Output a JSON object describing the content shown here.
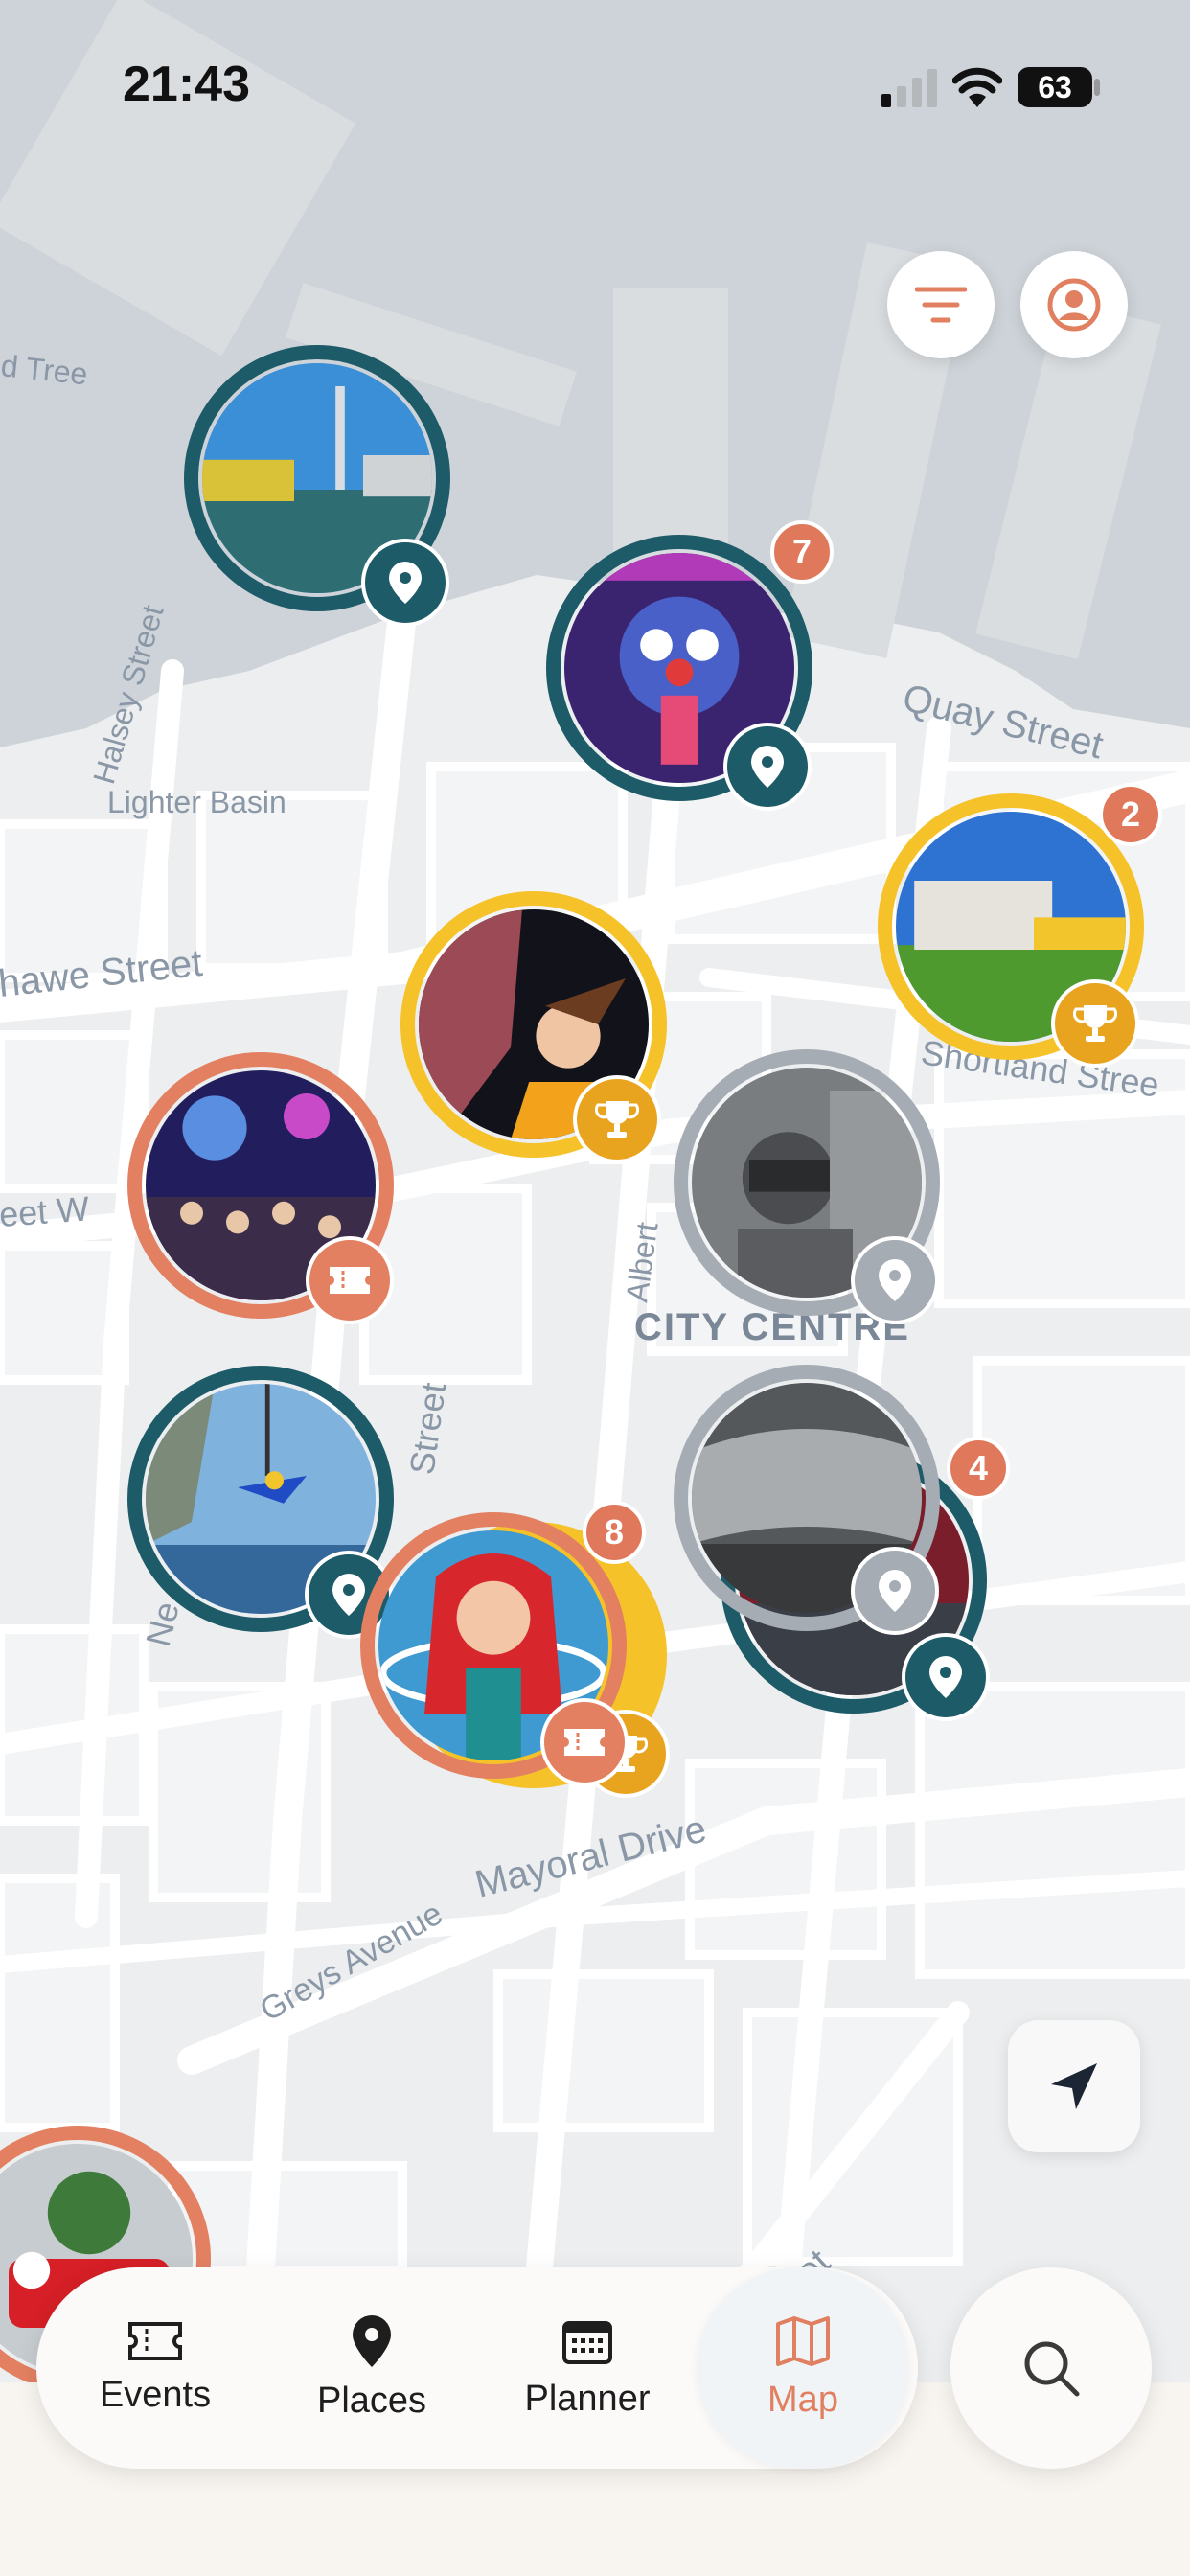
{
  "status_bar": {
    "time": "21:43",
    "battery": "63"
  },
  "map": {
    "labels": [
      "d Tree",
      "Halsey Street",
      "Lighter Basin",
      "Quay Street",
      "hawe Street",
      "Shortland Stree",
      "eet W",
      "Street",
      "Albert",
      "CITY CENTRE",
      "Ne",
      "Mayoral Drive",
      "Greys Avenue",
      "nds Street"
    ]
  },
  "clusters": [
    {
      "type": "place",
      "count": ""
    },
    {
      "type": "place",
      "count": "7"
    },
    {
      "type": "award",
      "count": "2"
    },
    {
      "type": "award",
      "count": ""
    },
    {
      "type": "event",
      "count": ""
    },
    {
      "type": "place",
      "count": ""
    },
    {
      "type": "place",
      "count": ""
    },
    {
      "type": "event",
      "count": "8"
    },
    {
      "type": "place",
      "count": "4"
    }
  ],
  "nav": {
    "events": "Events",
    "places": "Places",
    "planner": "Planner",
    "map": "Map"
  },
  "colors": {
    "accent": "#e08060",
    "teal": "#1d5b68",
    "gold": "#f5c22a",
    "gray": "#a6acb4"
  },
  "icons": {
    "filter": "filter-icon",
    "profile": "profile-icon",
    "locate": "navigation-arrow-icon",
    "search": "search-icon"
  }
}
